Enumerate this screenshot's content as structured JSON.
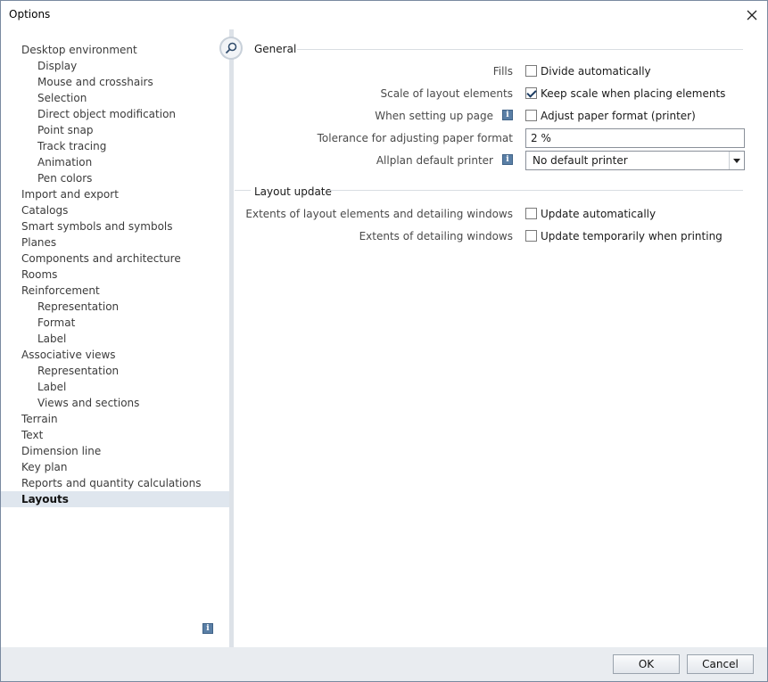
{
  "window": {
    "title": "Options"
  },
  "tree": {
    "items": [
      {
        "label": "Desktop environment",
        "level": 0
      },
      {
        "label": "Display",
        "level": 1
      },
      {
        "label": "Mouse and crosshairs",
        "level": 1
      },
      {
        "label": "Selection",
        "level": 1
      },
      {
        "label": "Direct object modification",
        "level": 1
      },
      {
        "label": "Point snap",
        "level": 1
      },
      {
        "label": "Track tracing",
        "level": 1
      },
      {
        "label": "Animation",
        "level": 1
      },
      {
        "label": "Pen colors",
        "level": 1
      },
      {
        "label": "Import and export",
        "level": 0
      },
      {
        "label": "Catalogs",
        "level": 0
      },
      {
        "label": "Smart symbols and symbols",
        "level": 0
      },
      {
        "label": "Planes",
        "level": 0
      },
      {
        "label": "Components and architecture",
        "level": 0
      },
      {
        "label": "Rooms",
        "level": 0
      },
      {
        "label": "Reinforcement",
        "level": 0
      },
      {
        "label": "Representation",
        "level": 1
      },
      {
        "label": "Format",
        "level": 1
      },
      {
        "label": "Label",
        "level": 1
      },
      {
        "label": "Associative views",
        "level": 0
      },
      {
        "label": "Representation",
        "level": 1
      },
      {
        "label": "Label",
        "level": 1
      },
      {
        "label": "Views and sections",
        "level": 1
      },
      {
        "label": "Terrain",
        "level": 0
      },
      {
        "label": "Text",
        "level": 0
      },
      {
        "label": "Dimension line",
        "level": 0
      },
      {
        "label": "Key plan",
        "level": 0
      },
      {
        "label": "Reports and quantity calculations",
        "level": 0
      },
      {
        "label": "Layouts",
        "level": 0,
        "selected": true
      }
    ]
  },
  "general": {
    "heading": "General",
    "fills_label": "Fills",
    "fills_check": {
      "label": "Divide automatically",
      "checked": false
    },
    "scale_label": "Scale of layout elements",
    "scale_check": {
      "label": "Keep scale when placing elements",
      "checked": true
    },
    "setup_label": "When setting up page",
    "setup_check": {
      "label": "Adjust paper format (printer)",
      "checked": false
    },
    "tolerance_label": "Tolerance for adjusting paper format",
    "tolerance_value": "2 %",
    "printer_label": "Allplan default printer",
    "printer_value": "No default printer"
  },
  "layout_update": {
    "heading": "Layout update",
    "extents_label": "Extents of layout elements and detailing windows",
    "extents_check": {
      "label": "Update automatically",
      "checked": false
    },
    "detail_label": "Extents of detailing windows",
    "detail_check": {
      "label": "Update temporarily when printing",
      "checked": false
    }
  },
  "footer": {
    "ok": "OK",
    "cancel": "Cancel"
  },
  "colors": {
    "selection": "#dfe6ee",
    "info_icon": "#5a7fa6",
    "footer_bg": "#e9ecf0"
  },
  "icons": {
    "close": "close-icon",
    "search": "search-icon",
    "info": "info-icon",
    "dropdown": "chevron-down-icon"
  }
}
